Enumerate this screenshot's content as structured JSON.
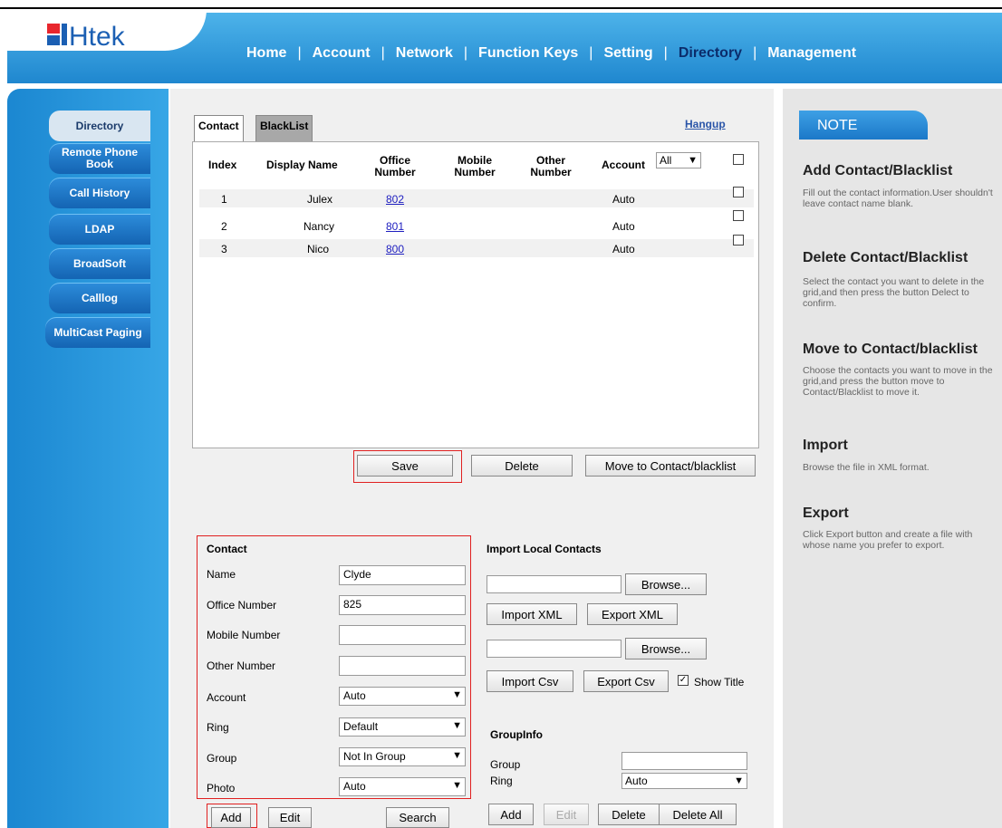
{
  "brand": {
    "logo_text": "Htek",
    "accent": "#e8262d",
    "blue": "#1b87d1"
  },
  "nav": {
    "items": [
      "Home",
      "Account",
      "Network",
      "Function Keys",
      "Setting",
      "Directory",
      "Management"
    ],
    "active": "Directory"
  },
  "sidebar": {
    "items": [
      "Directory",
      "Remote Phone Book",
      "Call History",
      "LDAP",
      "BroadSoft",
      "Calllog",
      "MultiCast Paging"
    ],
    "active": "Directory"
  },
  "tabs": {
    "contact": "Contact",
    "blacklist": "BlackList"
  },
  "hangup": "Hangup",
  "grid": {
    "headers": {
      "index": "Index",
      "display_name": "Display Name",
      "office": "Office Number",
      "mobile": "Mobile Number",
      "other": "Other Number",
      "account": "Account"
    },
    "account_filter": "All",
    "rows": [
      {
        "index": "1",
        "name": "Julex",
        "office": "802",
        "account": "Auto"
      },
      {
        "index": "2",
        "name": "Nancy",
        "office": "801",
        "account": "Auto"
      },
      {
        "index": "3",
        "name": "Nico",
        "office": "800",
        "account": "Auto"
      }
    ]
  },
  "grid_buttons": {
    "save": "Save",
    "delete": "Delete",
    "move": "Move to Contact/blacklist"
  },
  "contact_form": {
    "title": "Contact",
    "name_label": "Name",
    "name_value": "Clyde",
    "office_label": "Office Number",
    "office_value": "825",
    "mobile_label": "Mobile Number",
    "mobile_value": "",
    "other_label": "Other Number",
    "other_value": "",
    "account_label": "Account",
    "account_value": "Auto",
    "ring_label": "Ring",
    "ring_value": "Default",
    "group_label": "Group",
    "group_value": "Not In Group",
    "photo_label": "Photo",
    "photo_value": "Auto",
    "add": "Add",
    "edit": "Edit",
    "search": "Search"
  },
  "import": {
    "title": "Import Local Contacts",
    "browse": "Browse...",
    "import_xml": "Import XML",
    "export_xml": "Export XML",
    "import_csv": "Import Csv",
    "export_csv": "Export Csv",
    "show_title": "Show Title"
  },
  "groupinfo": {
    "title": "GroupInfo",
    "group_label": "Group",
    "group_value": "",
    "ring_label": "Ring",
    "ring_value": "Auto",
    "add": "Add",
    "edit": "Edit",
    "delete": "Delete",
    "delete_all": "Delete All"
  },
  "note": {
    "title": "NOTE",
    "sections": [
      {
        "heading": "Add Contact/Blacklist",
        "text": "Fill out the contact information.User shouldn't leave contact name blank."
      },
      {
        "heading": "Delete Contact/Blacklist",
        "text": "Select the contact you want to delete in the grid,and then press the button Delect to confirm."
      },
      {
        "heading": "Move to Contact/blacklist",
        "text": "Choose the contacts you want to move in the grid,and press the button move to Contact/Blacklist to move it."
      },
      {
        "heading": "Import",
        "text": "Browse the file in XML format."
      },
      {
        "heading": "Export",
        "text": "Click Export button and create a file with whose name you prefer to export."
      }
    ]
  }
}
